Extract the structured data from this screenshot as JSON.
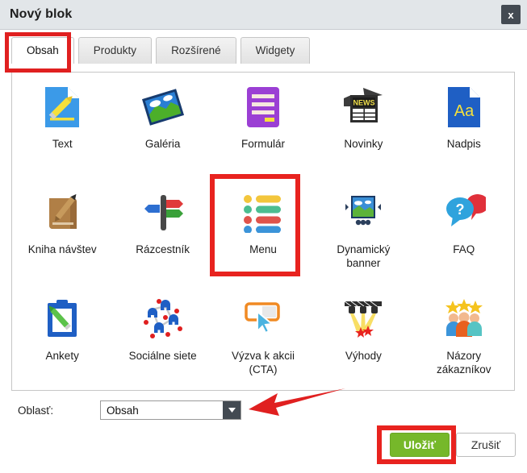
{
  "window": {
    "title": "Nový blok",
    "close_label": "x",
    "close_icon": "close-icon"
  },
  "tabs": [
    {
      "label": "Obsah",
      "active": true
    },
    {
      "label": "Produkty",
      "active": false
    },
    {
      "label": "Rozšírené",
      "active": false
    },
    {
      "label": "Widgety",
      "active": false
    }
  ],
  "blocks": [
    {
      "label": "Text",
      "icon": "document-pencil-icon"
    },
    {
      "label": "Galéria",
      "icon": "gallery-photo-icon"
    },
    {
      "label": "Formulár",
      "icon": "form-lines-icon"
    },
    {
      "label": "Novinky",
      "icon": "newspaper-icon"
    },
    {
      "label": "Nadpis",
      "icon": "heading-aa-icon"
    },
    {
      "label": "Kniha návštev",
      "icon": "guestbook-pencil-icon"
    },
    {
      "label": "Rázcestník",
      "icon": "signpost-icon"
    },
    {
      "label": "Menu",
      "icon": "bullet-list-icon"
    },
    {
      "label": "Dynamický banner",
      "icon": "dynamic-banner-icon"
    },
    {
      "label": "FAQ",
      "icon": "speech-bubbles-question-icon"
    },
    {
      "label": "Ankety",
      "icon": "clipboard-pencil-icon"
    },
    {
      "label": "Sociálne siete",
      "icon": "social-network-icon"
    },
    {
      "label": "Výzva k akcii (CTA)",
      "icon": "cta-cursor-button-icon"
    },
    {
      "label": "Výhody",
      "icon": "spotlights-stars-icon"
    },
    {
      "label": "Názory zákazníkov",
      "icon": "testimonials-stars-people-icon"
    }
  ],
  "area_field": {
    "label": "Oblasť:",
    "selected": "Obsah",
    "options": [
      "Obsah"
    ],
    "arrow_icon": "chevron-down-icon"
  },
  "footer": {
    "save_label": "Uložiť",
    "cancel_label": "Zrušiť"
  },
  "annotations": {
    "highlight_color": "#e8231f",
    "arrow_color": "#e02020",
    "highlighted": [
      "tab-obsah",
      "block-menu",
      "save-button"
    ]
  }
}
